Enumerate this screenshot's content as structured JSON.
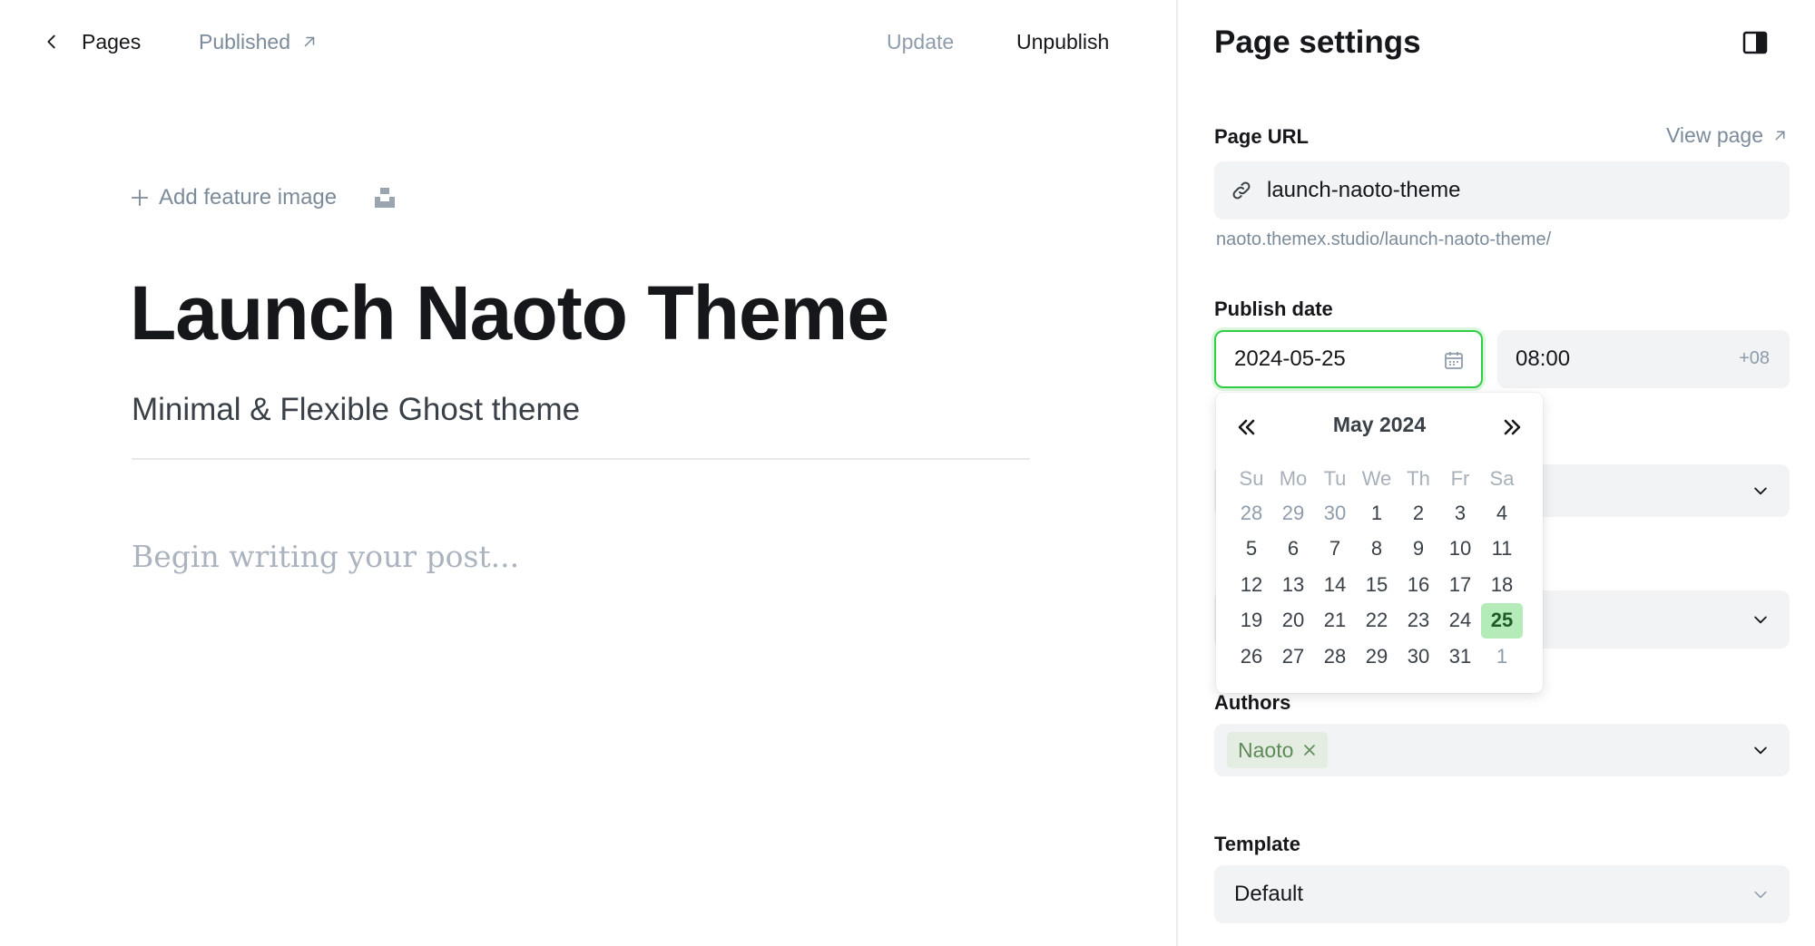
{
  "topbar": {
    "back_label": "Pages",
    "status_label": "Published",
    "update_label": "Update",
    "unpublish_label": "Unpublish"
  },
  "editor": {
    "add_feature_image": "Add feature image",
    "title": "Launch Naoto Theme",
    "excerpt": "Minimal & Flexible Ghost theme",
    "body_placeholder": "Begin writing your post..."
  },
  "settings": {
    "title": "Page settings",
    "page_url_label": "Page URL",
    "view_page_label": "View page",
    "slug": "launch-naoto-theme",
    "url_hint": "naoto.themex.studio/launch-naoto-theme/",
    "publish_date_label": "Publish date",
    "date_value": "2024-05-25",
    "time_value": "08:00",
    "timezone": "+08",
    "authors_label": "Authors",
    "authors": [
      "Naoto"
    ],
    "template_label": "Template",
    "template_value": "Default"
  },
  "datepicker": {
    "month_label": "May 2024",
    "weekdays": [
      "Su",
      "Mo",
      "Tu",
      "We",
      "Th",
      "Fr",
      "Sa"
    ],
    "weeks": [
      [
        "28",
        "29",
        "30",
        "1",
        "2",
        "3",
        "4"
      ],
      [
        "5",
        "6",
        "7",
        "8",
        "9",
        "10",
        "11"
      ],
      [
        "12",
        "13",
        "14",
        "15",
        "16",
        "17",
        "18"
      ],
      [
        "19",
        "20",
        "21",
        "22",
        "23",
        "24",
        "25"
      ],
      [
        "26",
        "27",
        "28",
        "29",
        "30",
        "31",
        "1"
      ]
    ],
    "selected_day": "25"
  },
  "colors": {
    "accent": "#30cf43",
    "selected_bg": "#b5ebb9",
    "chip_bg": "#e5ede2",
    "chip_text": "#5e8a58",
    "field_bg": "#f1f3f4"
  }
}
